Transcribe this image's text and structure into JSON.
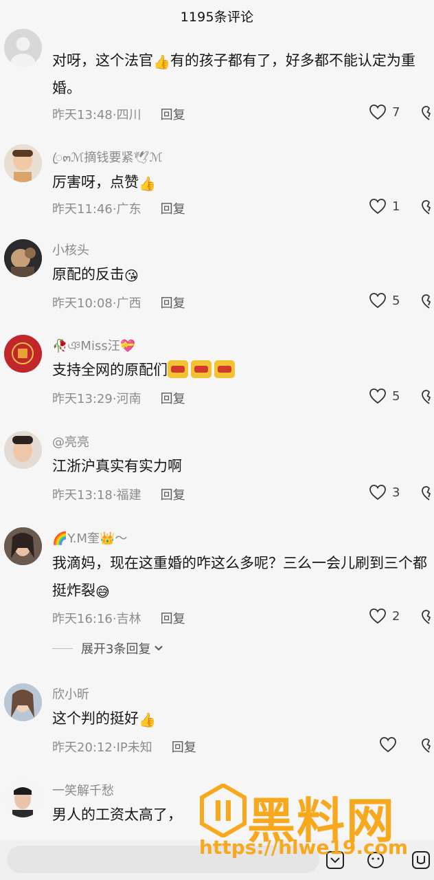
{
  "header": {
    "title": "1195条评论"
  },
  "reply_label": "回复",
  "comments": [
    {
      "username": "",
      "text": "对呀，这个法官",
      "emoji_after": "👍",
      "text2": "有的孩子都有了，好多都不能认定为重婚。",
      "time": "昨天13:48·四川",
      "likes": "7"
    },
    {
      "username": "ꦿ๓ℳ摘钱要紧🕊ℳ",
      "text": "厉害呀，点赞",
      "emoji_after": "👍",
      "time": "昨天11:46·广东",
      "likes": "1"
    },
    {
      "username": "小核头",
      "text": "原配的反击",
      "emoji_after": "😘",
      "time": "昨天10:08·广西",
      "likes": "5"
    },
    {
      "username": "🥀ঞMiss汪💝",
      "text": "支持全网的原配们",
      "time": "昨天13:29·河南",
      "likes": "5"
    },
    {
      "username": "@亮亮",
      "text": "江浙沪真实有实力啊",
      "time": "昨天13:18·福建",
      "likes": "3"
    },
    {
      "username": "🌈Y.M奎👑～",
      "text": "我滴妈，现在这重婚的咋这么多呢？三么一会儿刷到三个都挺炸裂",
      "emoji_after": "😅",
      "time": "昨天16:16·吉林",
      "likes": "2"
    },
    {
      "username": "欣小昕",
      "text": "这个判的挺好",
      "emoji_after": "👍",
      "time": "昨天20:12·IP未知",
      "likes": ""
    },
    {
      "username": "一笑解千愁",
      "text": "男人的工资太高了，",
      "time": "",
      "likes": ""
    }
  ],
  "expand_replies": "展开3条回复",
  "watermark": {
    "main": "黑料网",
    "url": "https://hlwe19.com"
  },
  "colors": {
    "accent_watermark": "#f7a81c",
    "text": "#161616",
    "muted": "#8c8c8c"
  }
}
